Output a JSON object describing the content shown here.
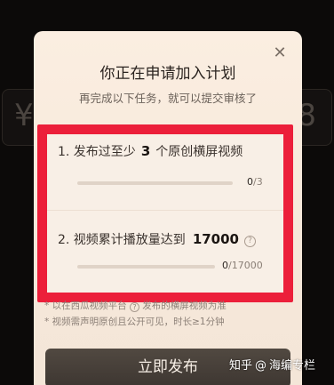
{
  "dialog": {
    "close_glyph": "✕",
    "title": "你正在申请加入计划",
    "subtitle": "再完成以下任务，就可以提交审核了"
  },
  "tasks": [
    {
      "prefix": "1. 发布过至少",
      "number": "3",
      "suffix": "个原创横屏视频",
      "progress_current": "0",
      "progress_total": "/3",
      "progress": 0.0
    },
    {
      "prefix": "2. 视频累计播放量达到",
      "number": "17000",
      "help_glyph": "?",
      "progress_current": "0",
      "progress_total": "/17000",
      "progress": 0.0
    }
  ],
  "notes": {
    "line1_a": "* 以在西瓜视频平台",
    "line1_q": "?",
    "line1_b": "发布的横屏视频为准",
    "line2": "* 视频需声明原创且公开可见，时长≥1分钟"
  },
  "publish_button": "立即发布",
  "background": {
    "currency_symbol": "¥",
    "trailing_digit": "8"
  },
  "watermark": {
    "site": "知乎",
    "sep": "@",
    "author": "海编专栏"
  },
  "colors": {
    "highlight": "#ec1f3a",
    "dialog_bg": "#fbeee1",
    "button_bg": "#3d3631"
  }
}
